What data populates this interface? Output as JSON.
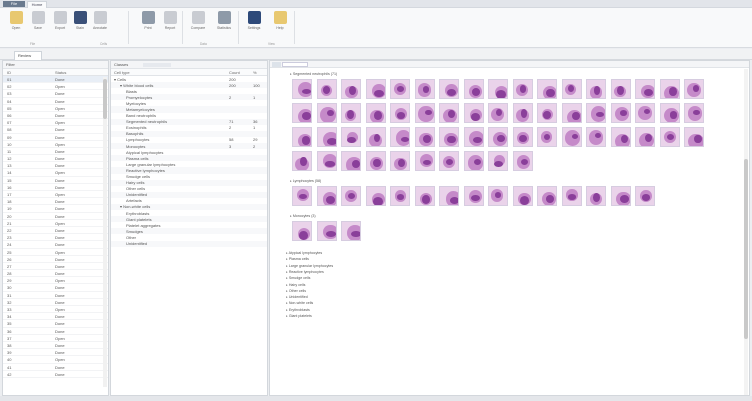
{
  "titlebar": {
    "app_tab": "File",
    "active_tab": "Home"
  },
  "ribbon": {
    "buttons": [
      {
        "label": "Open",
        "icon": "folder-icon",
        "color": "#e8c870"
      },
      {
        "label": "Save",
        "icon": "save-icon",
        "color": "#c9ccd2"
      },
      {
        "label": "Export",
        "icon": "export-icon",
        "color": "#c9ccd2"
      },
      {
        "label": "Stain",
        "icon": "droplet-icon",
        "color": "#3a5078"
      },
      {
        "label": "Annotate",
        "icon": "pen-icon",
        "color": "#c9ccd2"
      },
      {
        "label": "Print",
        "icon": "print-icon",
        "color": "#8e9aa8"
      },
      {
        "label": "Report",
        "icon": "report-icon",
        "color": "#c9ccd2"
      },
      {
        "label": "Compare",
        "icon": "compare-icon",
        "color": "#c9ccd2"
      },
      {
        "label": "Statistics",
        "icon": "table-icon",
        "color": "#8e9aa8"
      },
      {
        "label": "Settings",
        "icon": "gear-icon",
        "color": "#2e4a7a"
      },
      {
        "label": "Help",
        "icon": "help-icon",
        "color": "#e8c870"
      }
    ],
    "groups": [
      "File",
      "Cells",
      "Data",
      "View"
    ]
  },
  "doc_tab": "Review",
  "left_panel": {
    "toolbar": "Filter",
    "headers": [
      "ID",
      "Status"
    ],
    "rows": [
      {
        "id": "01",
        "status": "Done"
      },
      {
        "id": "02",
        "status": "Open"
      },
      {
        "id": "03",
        "status": "Done"
      },
      {
        "id": "04",
        "status": "Done"
      },
      {
        "id": "05",
        "status": "Open"
      },
      {
        "id": "06",
        "status": "Done"
      },
      {
        "id": "07",
        "status": "Open"
      },
      {
        "id": "08",
        "status": "Done"
      },
      {
        "id": "09",
        "status": "Done"
      },
      {
        "id": "10",
        "status": "Open"
      },
      {
        "id": "11",
        "status": "Done"
      },
      {
        "id": "12",
        "status": "Done"
      },
      {
        "id": "13",
        "status": "Done"
      },
      {
        "id": "14",
        "status": "Open"
      },
      {
        "id": "15",
        "status": "Done"
      },
      {
        "id": "16",
        "status": "Done"
      },
      {
        "id": "17",
        "status": "Open"
      },
      {
        "id": "18",
        "status": "Done"
      },
      {
        "id": "19",
        "status": "Done"
      },
      {
        "id": "20",
        "status": "Done"
      },
      {
        "id": "21",
        "status": "Open"
      },
      {
        "id": "22",
        "status": "Done"
      },
      {
        "id": "23",
        "status": "Done"
      },
      {
        "id": "24",
        "status": "Done"
      },
      {
        "id": "25",
        "status": "Open"
      },
      {
        "id": "26",
        "status": "Done"
      },
      {
        "id": "27",
        "status": "Done"
      },
      {
        "id": "28",
        "status": "Done"
      },
      {
        "id": "29",
        "status": "Open"
      },
      {
        "id": "30",
        "status": "Done"
      },
      {
        "id": "31",
        "status": "Done"
      },
      {
        "id": "32",
        "status": "Done"
      },
      {
        "id": "33",
        "status": "Open"
      },
      {
        "id": "34",
        "status": "Done"
      },
      {
        "id": "35",
        "status": "Done"
      },
      {
        "id": "36",
        "status": "Done"
      },
      {
        "id": "37",
        "status": "Open"
      },
      {
        "id": "38",
        "status": "Done"
      },
      {
        "id": "39",
        "status": "Done"
      },
      {
        "id": "40",
        "status": "Open"
      },
      {
        "id": "41",
        "status": "Done"
      },
      {
        "id": "42",
        "status": "Done"
      }
    ]
  },
  "mid_panel": {
    "toolbar": "Classes",
    "headers": [
      "Cell type",
      "Count",
      "%"
    ],
    "rows": [
      {
        "label": "Cells",
        "indent": 0,
        "count": "200",
        "pct": ""
      },
      {
        "label": "White blood cells",
        "indent": 1,
        "count": "200",
        "pct": "100"
      },
      {
        "label": "Blasts",
        "indent": 2,
        "count": "",
        "pct": ""
      },
      {
        "label": "Promyelocytes",
        "indent": 2,
        "count": "2",
        "pct": "1"
      },
      {
        "label": "Myelocytes",
        "indent": 2,
        "count": "",
        "pct": ""
      },
      {
        "label": "Metamyelocytes",
        "indent": 2,
        "count": "",
        "pct": ""
      },
      {
        "label": "Band neutrophils",
        "indent": 2,
        "count": "",
        "pct": ""
      },
      {
        "label": "Segmented neutrophils",
        "indent": 2,
        "count": "71",
        "pct": "36"
      },
      {
        "label": "Eosinophils",
        "indent": 2,
        "count": "2",
        "pct": "1"
      },
      {
        "label": "Basophils",
        "indent": 2,
        "count": "",
        "pct": ""
      },
      {
        "label": "Lymphocytes",
        "indent": 2,
        "count": "58",
        "pct": "29"
      },
      {
        "label": "Monocytes",
        "indent": 2,
        "count": "3",
        "pct": "2"
      },
      {
        "label": "Atypical lymphocytes",
        "indent": 2,
        "count": "",
        "pct": ""
      },
      {
        "label": "Plasma cells",
        "indent": 2,
        "count": "",
        "pct": ""
      },
      {
        "label": "Large granular lymphocytes",
        "indent": 2,
        "count": "",
        "pct": ""
      },
      {
        "label": "Reactive lymphocytes",
        "indent": 2,
        "count": "",
        "pct": ""
      },
      {
        "label": "Smudge cells",
        "indent": 2,
        "count": "",
        "pct": ""
      },
      {
        "label": "Hairy cells",
        "indent": 2,
        "count": "",
        "pct": ""
      },
      {
        "label": "Other cells",
        "indent": 2,
        "count": "",
        "pct": ""
      },
      {
        "label": "Unidentified",
        "indent": 2,
        "count": "",
        "pct": ""
      },
      {
        "label": "Artefacts",
        "indent": 2,
        "count": "",
        "pct": ""
      },
      {
        "label": "Non-white cells",
        "indent": 1,
        "count": "",
        "pct": ""
      },
      {
        "label": "Erythroblasts",
        "indent": 2,
        "count": "",
        "pct": ""
      },
      {
        "label": "Giant platelets",
        "indent": 2,
        "count": "",
        "pct": ""
      },
      {
        "label": "Platelet aggregates",
        "indent": 2,
        "count": "",
        "pct": ""
      },
      {
        "label": "Smudges",
        "indent": 2,
        "count": "",
        "pct": ""
      },
      {
        "label": "Other",
        "indent": 2,
        "count": "",
        "pct": ""
      },
      {
        "label": "Unidentified",
        "indent": 2,
        "count": "",
        "pct": ""
      }
    ]
  },
  "right_panel": {
    "toolbar": "Search",
    "groups": [
      {
        "title": "Segmented neutrophils",
        "count": 71
      },
      {
        "title": "Lymphocytes",
        "count": 58
      },
      {
        "title": "Monocytes",
        "count": 3
      }
    ],
    "collapsed_items": [
      "Atypical lymphocytes",
      "Plasma cells",
      "Large granular lymphocytes",
      "Reactive lymphocytes",
      "Smudge cells",
      "Hairy cells",
      "Other cells",
      "Unidentified",
      "Non-white cells",
      "Erythroblasts",
      "Giant platelets"
    ],
    "cell_colors": {
      "background": "#ead3ea",
      "nucleus": "#8a3f9a",
      "cytoplasm": "#c58ac9"
    }
  }
}
